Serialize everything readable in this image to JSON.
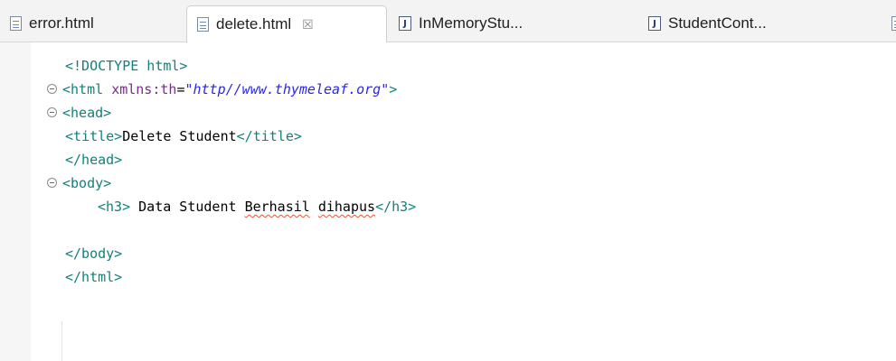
{
  "tabs": [
    {
      "label": "error.html",
      "icon": "html-file-icon",
      "active": false
    },
    {
      "label": "delete.html",
      "icon": "html-file-icon",
      "active": true,
      "close": "☒"
    },
    {
      "label": "InMemoryStu...",
      "icon": "java-file-icon",
      "active": false
    },
    {
      "label": "StudentCont...",
      "icon": "java-file-icon",
      "active": false
    }
  ],
  "editor": {
    "lines": {
      "l1": {
        "tag": "<!DOCTYPE html>"
      },
      "l2": {
        "open": "<html ",
        "attr": "xmlns:th",
        "eq": "=",
        "value": "\"http//www.thymeleaf.org\"",
        "close": ">"
      },
      "l3": {
        "tag": "<head>"
      },
      "l4": {
        "open": "<title>",
        "text": "Delete Student",
        "close": "</title>"
      },
      "l5": {
        "tag": "</head>"
      },
      "l6": {
        "tag": "<body>"
      },
      "l7": {
        "open": "<h3>",
        "text1": " Data Student ",
        "word1": "Berhasil",
        "space": " ",
        "word2": "dihapus",
        "close": "</h3>"
      },
      "l8": {
        "tag": ""
      },
      "l9": {
        "tag": "</body>"
      },
      "l10": {
        "tag": "</html>"
      }
    }
  },
  "colors": {
    "tag": "#157f7a",
    "attribute": "#7b2a8e",
    "string": "#2a27e8",
    "spellcheck": "#e05a3a"
  }
}
